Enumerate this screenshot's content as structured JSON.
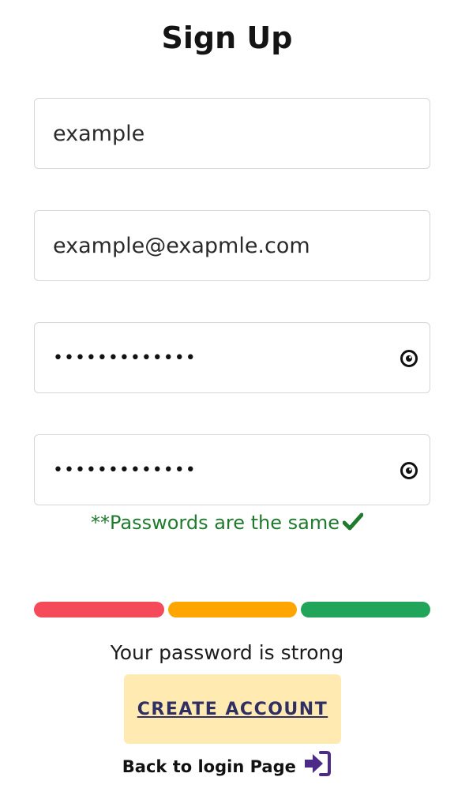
{
  "page": {
    "title": "Sign Up"
  },
  "form": {
    "username": {
      "value": "example"
    },
    "email": {
      "value": "example@exapmle.com"
    },
    "password": {
      "value": "•••••••••••••",
      "icon": "eye-icon"
    },
    "confirm_password": {
      "value": "•••••••••••••",
      "icon": "eye-icon"
    }
  },
  "validation": {
    "match_message": "**Passwords are the same",
    "match_icon": "checkmark-icon",
    "match_color": "#1f7a2e"
  },
  "strength": {
    "level": 3,
    "max_level": 3,
    "segment_colors": [
      "#f44a5a",
      "#ffa500",
      "#21a55a"
    ],
    "message": "Your password is strong"
  },
  "actions": {
    "create_account_label": "CREATE ACCOUNT",
    "back_to_login_label": "Back to login Page",
    "back_icon": "sign-in-icon",
    "back_icon_color": "#4b2a88",
    "button_color": "#ffeab1",
    "button_text_color": "#2f2f63"
  }
}
